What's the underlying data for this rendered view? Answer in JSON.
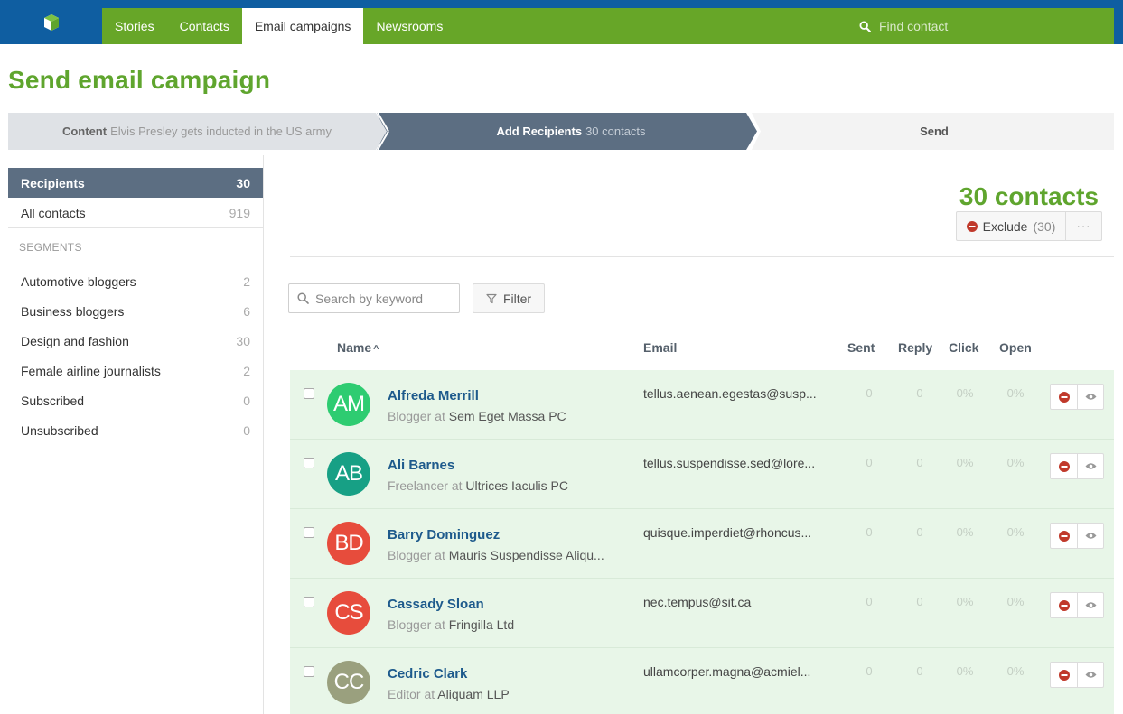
{
  "nav": {
    "logo_icon": "newsroom-logo-icon",
    "items": [
      "Stories",
      "Contacts",
      "Email campaigns",
      "Newsrooms"
    ],
    "active": "Email campaigns",
    "search_placeholder": "Find contact"
  },
  "page_title": "Send email campaign",
  "steps": [
    {
      "label": "Content",
      "detail": "Elvis Presley gets inducted in the US army"
    },
    {
      "label": "Add Recipients",
      "detail": "30 contacts"
    },
    {
      "label": "Send",
      "detail": ""
    }
  ],
  "sidebar": {
    "recipients": {
      "label": "Recipients",
      "count": "30"
    },
    "all_contacts": {
      "label": "All contacts",
      "count": "919"
    },
    "segments_heading": "SEGMENTS",
    "segments": [
      {
        "label": "Automotive bloggers",
        "count": "2"
      },
      {
        "label": "Business bloggers",
        "count": "6"
      },
      {
        "label": "Design and fashion",
        "count": "30"
      },
      {
        "label": "Female airline journalists",
        "count": "2"
      },
      {
        "label": "Subscribed",
        "count": "0"
      },
      {
        "label": "Unsubscribed",
        "count": "0"
      }
    ]
  },
  "main": {
    "contacts_count": "30 contacts",
    "exclude_label": "Exclude",
    "exclude_count": "(30)",
    "more_label": "···",
    "search_placeholder": "Search by keyword",
    "filter_label": "Filter",
    "columns": {
      "name": "Name",
      "email": "Email",
      "sent": "Sent",
      "reply": "Reply",
      "click": "Click",
      "open": "Open"
    },
    "sort_indicator": "^"
  },
  "contacts": [
    {
      "initials": "AM",
      "name": "Alfreda Merrill",
      "role": "Blogger",
      "at": "at",
      "org": "Sem Eget Massa PC",
      "email": "tellus.aenean.egestas@susp...",
      "sent": "0",
      "reply": "0",
      "click": "0%",
      "open": "0%",
      "color": "#2ecc71"
    },
    {
      "initials": "AB",
      "name": "Ali Barnes",
      "role": "Freelancer",
      "at": "at",
      "org": "Ultrices Iaculis PC",
      "email": "tellus.suspendisse.sed@lore...",
      "sent": "0",
      "reply": "0",
      "click": "0%",
      "open": "0%",
      "color": "#17a085"
    },
    {
      "initials": "BD",
      "name": "Barry Dominguez",
      "role": "Blogger",
      "at": "at",
      "org": "Mauris Suspendisse Aliqu...",
      "email": "quisque.imperdiet@rhoncus...",
      "sent": "0",
      "reply": "0",
      "click": "0%",
      "open": "0%",
      "color": "#e74c3c"
    },
    {
      "initials": "CS",
      "name": "Cassady Sloan",
      "role": "Blogger",
      "at": "at",
      "org": "Fringilla Ltd",
      "email": "nec.tempus@sit.ca",
      "sent": "0",
      "reply": "0",
      "click": "0%",
      "open": "0%",
      "color": "#e74c3c"
    },
    {
      "initials": "CC",
      "name": "Cedric Clark",
      "role": "Editor",
      "at": "at",
      "org": "Aliquam LLP",
      "email": "ullamcorper.magna@acmiel...",
      "sent": "0",
      "reply": "0",
      "click": "0%",
      "open": "0%",
      "color": "#9aa07e"
    }
  ],
  "colors": {
    "brand_green": "#67a628",
    "header_blue": "#0f5ea1",
    "step_active": "#5c6e82",
    "row_bg": "#e8f6e8",
    "exclude_red": "#c0392b"
  }
}
